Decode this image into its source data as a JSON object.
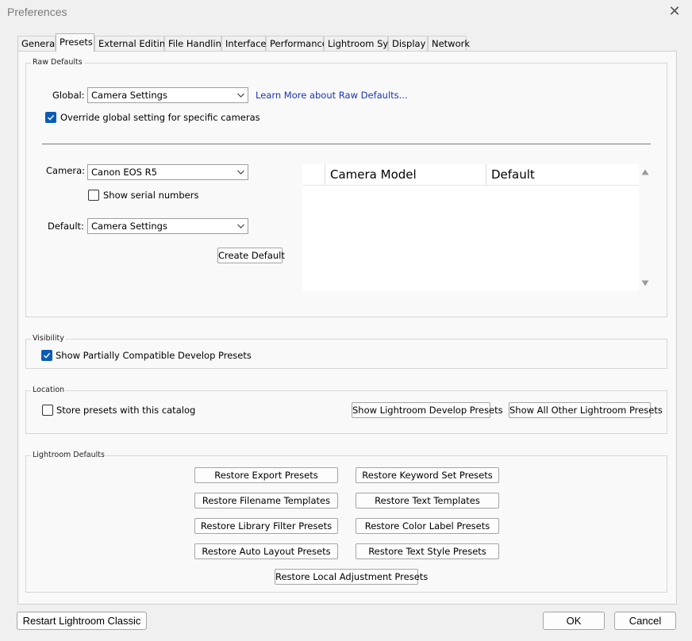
{
  "window": {
    "title": "Preferences"
  },
  "tabs": [
    {
      "label": "General"
    },
    {
      "label": "Presets",
      "active": true
    },
    {
      "label": "External Editing"
    },
    {
      "label": "File Handling"
    },
    {
      "label": "Interface"
    },
    {
      "label": "Performance"
    },
    {
      "label": "Lightroom Sync"
    },
    {
      "label": "Display"
    },
    {
      "label": "Network"
    }
  ],
  "raw_defaults": {
    "legend": "Raw Defaults",
    "global_label": "Global:",
    "global_value": "Camera Settings",
    "learn_more": "Learn More about Raw Defaults...",
    "override_label": "Override global setting for specific cameras",
    "override_checked": true,
    "camera_label": "Camera:",
    "camera_value": "Canon EOS R5",
    "serial_label": "Show serial numbers",
    "serial_checked": false,
    "default_label": "Default:",
    "default_value": "Camera Settings",
    "create_default": "Create Default",
    "table_headers": [
      "Camera Model",
      "Default"
    ]
  },
  "visibility": {
    "legend": "Visibility",
    "show_partial_label": "Show Partially Compatible Develop Presets",
    "show_partial_checked": true
  },
  "location": {
    "legend": "Location",
    "store_label": "Store presets with this catalog",
    "store_checked": false,
    "show_develop": "Show Lightroom Develop Presets",
    "show_other": "Show All Other Lightroom Presets"
  },
  "lightroom_defaults": {
    "legend": "Lightroom Defaults",
    "buttons": [
      "Restore Export Presets",
      "Restore Keyword Set Presets",
      "Restore Filename Templates",
      "Restore Text Templates",
      "Restore Library Filter Presets",
      "Restore Color Label Presets",
      "Restore Auto Layout Presets",
      "Restore Text Style Presets",
      "Restore Local Adjustment Presets"
    ]
  },
  "footer": {
    "restart": "Restart Lightroom Classic",
    "ok": "OK",
    "cancel": "Cancel"
  }
}
